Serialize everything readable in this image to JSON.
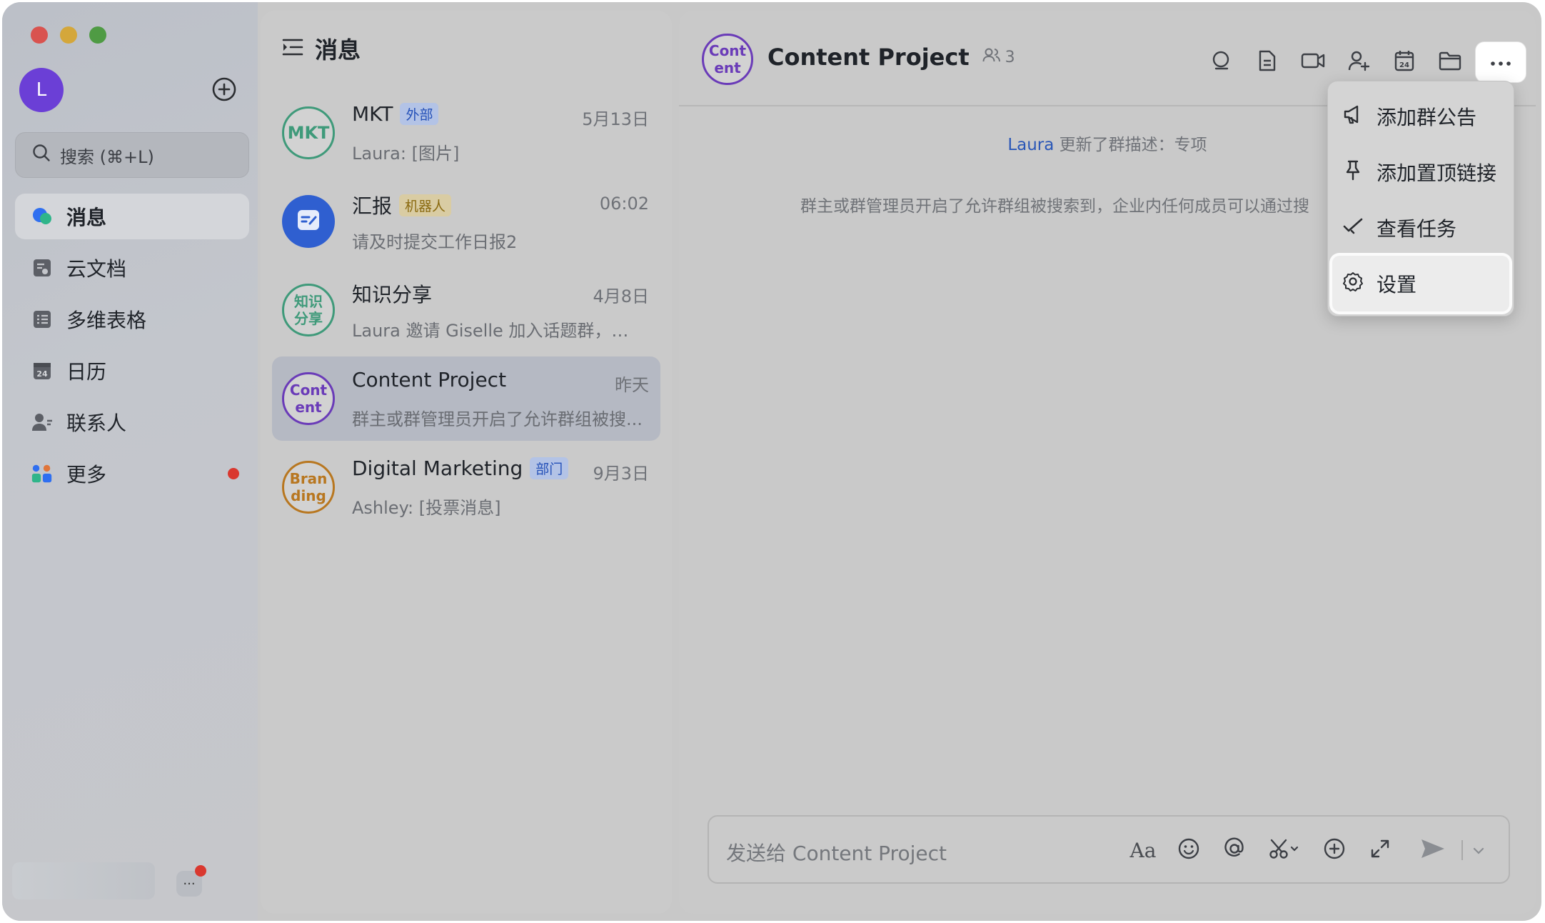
{
  "sidebar": {
    "avatar_initial": "L",
    "search_placeholder": "搜索 (⌘+L)",
    "nav": [
      {
        "label": "消息",
        "icon": "message-bubble-icon"
      },
      {
        "label": "云文档",
        "icon": "cloud-doc-icon"
      },
      {
        "label": "多维表格",
        "icon": "base-table-icon"
      },
      {
        "label": "日历",
        "icon": "calendar-icon"
      },
      {
        "label": "联系人",
        "icon": "contacts-icon"
      },
      {
        "label": "更多",
        "icon": "more-apps-icon"
      }
    ],
    "bottom_more": "···"
  },
  "conversations": {
    "header": "消息",
    "items": [
      {
        "avatar": "MKT",
        "name": "MKT",
        "tag": "外部",
        "time": "5月13日",
        "preview": "Laura: [图片]",
        "avatar_color": "#3f9a7a"
      },
      {
        "avatar": "",
        "name": "汇报",
        "tag": "机器人",
        "time": "06:02",
        "preview": "请及时提交工作日报2",
        "avatar_color": "#2f5fd0"
      },
      {
        "avatar": "知识\n分享",
        "name": "知识分享",
        "tag": "",
        "time": "4月8日",
        "preview": "Laura 邀请 Giselle 加入话题群，新...",
        "avatar_color": "#3f9a7a"
      },
      {
        "avatar": "Cont\nent",
        "name": "Content Project",
        "tag": "",
        "time": "昨天",
        "preview": "群主或群管理员开启了允许群组被搜...",
        "avatar_color": "#6a3bb8"
      },
      {
        "avatar": "Bran\nding",
        "name": "Digital Marketing",
        "tag": "部门",
        "time": "9月3日",
        "preview": "Ashley: [投票消息]",
        "avatar_color": "#b87720"
      }
    ]
  },
  "chat": {
    "avatar": "Cont\nent",
    "title": "Content Project",
    "member_count": "3",
    "system_msg_user": "Laura",
    "system_msg_text": "更新了群描述：专项",
    "system_msg_2": "群主或群管理员开启了允许群组被搜索到，企业内任何成员可以通过搜",
    "input_placeholder": "发送给 Content Project",
    "font_tool": "Aa"
  },
  "menu": {
    "items": [
      {
        "label": "添加群公告",
        "icon": "megaphone-icon"
      },
      {
        "label": "添加置顶链接",
        "icon": "pin-icon"
      },
      {
        "label": "查看任务",
        "icon": "task-check-icon"
      },
      {
        "label": "设置",
        "icon": "gear-icon"
      }
    ]
  }
}
